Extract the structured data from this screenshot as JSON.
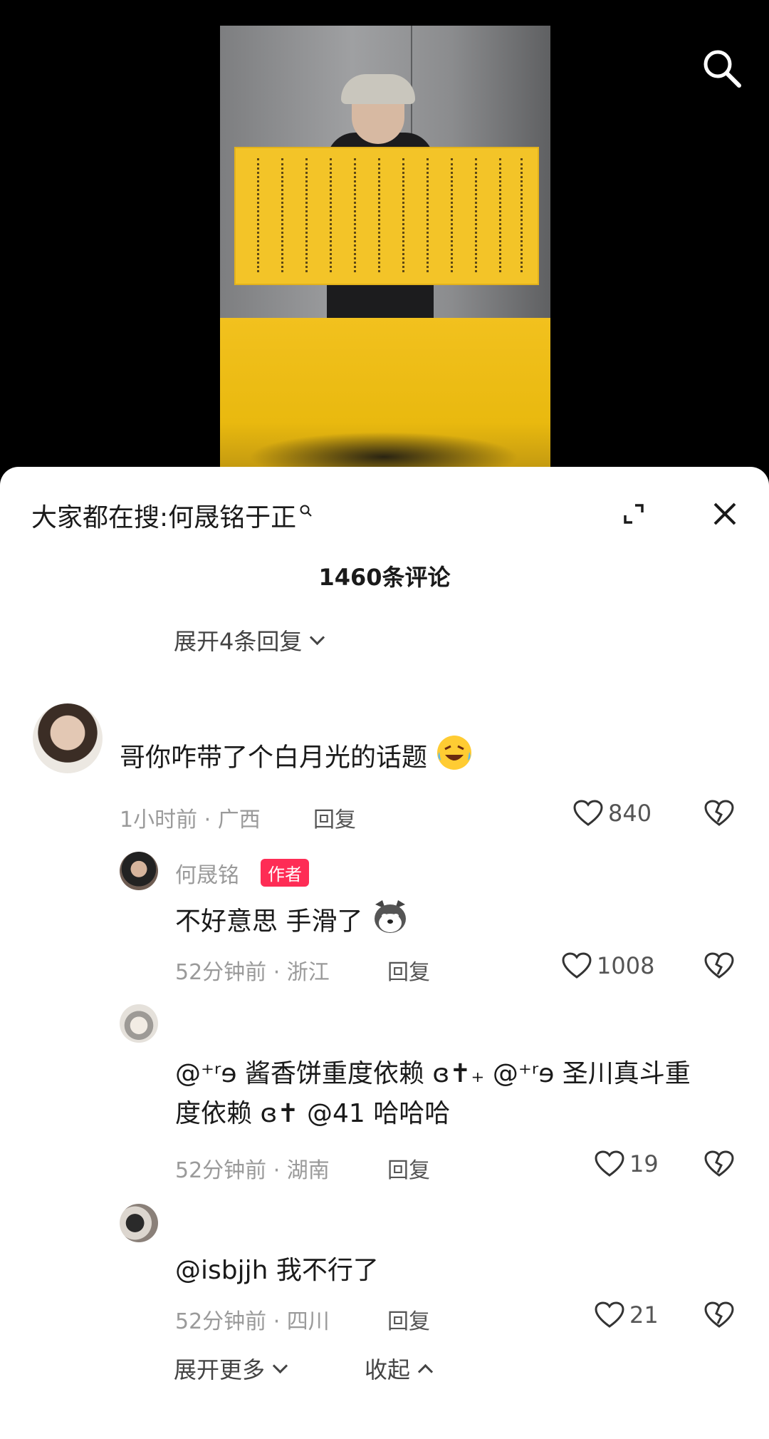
{
  "search_bar": {
    "label": "大家都在搜:",
    "query": "何晟铭于正"
  },
  "comments_count": "1460条评论",
  "expand_replies_label": "展开4条回复",
  "comments": [
    {
      "username": "",
      "text": "哥你咋带了个白月光的话题",
      "time": "1小时前",
      "location": "广西",
      "reply_label": "回复",
      "likes": "840"
    },
    {
      "username": "何晟铭",
      "badge": "作者",
      "text": "不好意思 手滑了",
      "time": "52分钟前",
      "location": "浙江",
      "reply_label": "回复",
      "likes": "1008"
    },
    {
      "username": "",
      "text_line1": "@⁺ʳɘ 酱香饼重度依赖 ɞ✝₊ @⁺ʳɘ 圣川真斗重",
      "text_line2": "度依赖 ɞ✝ @41 哈哈哈",
      "time": "52分钟前",
      "location": "湖南",
      "reply_label": "回复",
      "likes": "19"
    },
    {
      "username": "",
      "text": "@isbjjh 我不行了",
      "time": "52分钟前",
      "location": "四川",
      "reply_label": "回复",
      "likes": "21"
    }
  ],
  "footer": {
    "expand_more": "展开更多",
    "collapse": "收起"
  },
  "colors": {
    "badge": "#fe2c55",
    "scroll_paper": "#f3c428"
  }
}
